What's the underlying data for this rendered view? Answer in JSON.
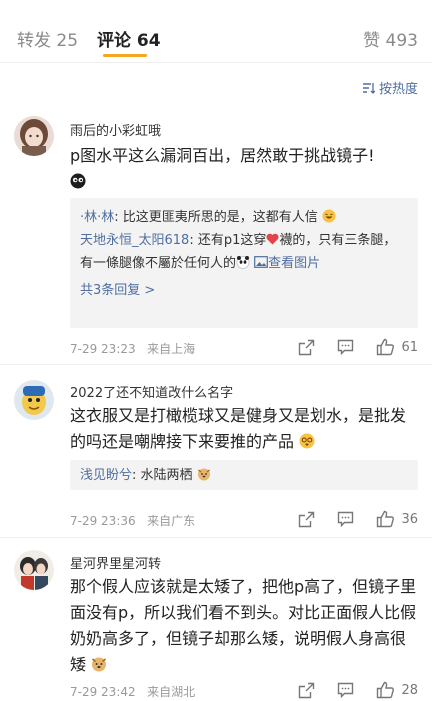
{
  "tabs": {
    "repost": "转发 25",
    "comments": "评论 64",
    "likes": "赞 493"
  },
  "sort": {
    "label": "按热度"
  },
  "comments": [
    {
      "username": "雨后的小彩虹哦",
      "text": "p图水平这么漏洞百出，居然敢于挑战镜子!",
      "replies": [
        {
          "name": "·林·林",
          "text": ": 比这更匪夷所思的是，这都有人信"
        },
        {
          "name": "天地永恒_太阳618",
          "text": ": 还有p1这穿",
          "text2": "襪的，只有三条腿，有一條腿像不屬於任何人的",
          "link": "查看图片"
        }
      ],
      "more": "共3条回复 >",
      "time": "7-29 23:23",
      "location": "来自上海",
      "likes": "61"
    },
    {
      "username": "2022了还不知道改什么名字",
      "text": "这衣服又是打橄榄球又是健身又是划水，是批发的吗还是嘲牌接下来要推的产品",
      "replies": [
        {
          "name": "浅见盼兮",
          "text": ": 水陆两栖"
        }
      ],
      "time": "7-29 23:36",
      "location": "来自广东",
      "likes": "36"
    },
    {
      "username": "星河界里星河转",
      "text": "那个假人应该就是太矮了，把他p高了，但镜子里面没有p，所以我们看不到头。对比正面假人比假奶奶高多了，但镜子却那么矮，说明假人身高很矮",
      "time": "7-29 23:42",
      "location": "来自湖北",
      "likes": "28"
    }
  ]
}
